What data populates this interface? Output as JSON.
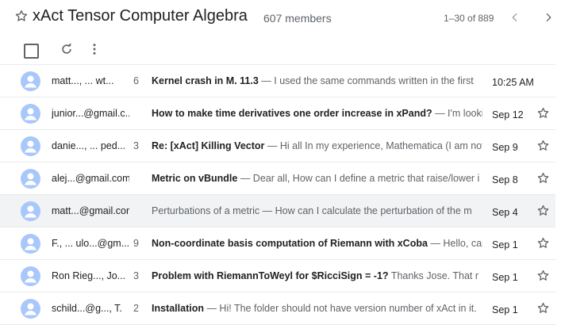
{
  "header": {
    "title": "xAct Tensor Computer Algebra",
    "members": "607 members",
    "pagination": "1–30 of 889"
  },
  "icons": {
    "favorite": "star-outline-icon",
    "prev": "chevron-left-icon",
    "next": "chevron-right-icon",
    "refresh": "refresh-icon",
    "more": "more-vert-icon",
    "avatar": "person-avatar-icon"
  },
  "colors": {
    "avatar": "#a8c7fa",
    "avatar_glyph": "#ffffff",
    "icon": "#5f6368"
  },
  "threads": [
    {
      "sender": "matt..., ... wt...",
      "count": "6",
      "subject": "Kernel crash in M. 11.3",
      "snippet": " — I used the same commands written in the first",
      "date": "10:25 AM"
    },
    {
      "sender": "junior...@gmail.c...",
      "count": "",
      "subject": "How to make time derivatives one order increase in xPand?",
      "snippet": " — I'm looking",
      "date": "Sep 12"
    },
    {
      "sender": "danie..., ... ped...",
      "count": "3",
      "subject": "Re: [xAct] Killing Vector",
      "snippet": " — Hi all In my experience, Mathematica (I am not",
      "date": "Sep 9"
    },
    {
      "sender": "alej...@gmail.com",
      "count": "",
      "subject": "Metric on vBundle",
      "snippet": " — Dear all, How can I define a metric that raise/lower i",
      "date": "Sep 8"
    },
    {
      "sender": "matt...@gmail.com",
      "count": "",
      "subject": "",
      "snippet": "Perturbations of a metric — How can I calculate the perturbation of the m",
      "date": "Sep 4"
    },
    {
      "sender": "F., ... ulo...@gm...",
      "count": "9",
      "subject": "Non-coordinate basis computation of Riemann with xCoba",
      "snippet": " — Hello, can",
      "date": "Sep 1"
    },
    {
      "sender": "Ron Rieg..., Jo...",
      "count": "3",
      "subject": "Problem with RiemannToWeyl for $RicciSign = -1?",
      "snippet": "     Thanks Jose. That r",
      "date": "Sep 1"
    },
    {
      "sender": "schild...@g..., T.",
      "count": "2",
      "subject": "Installation",
      "snippet": " — Hi! The folder should not have version number of xAct in it.",
      "date": "Sep 1"
    }
  ]
}
